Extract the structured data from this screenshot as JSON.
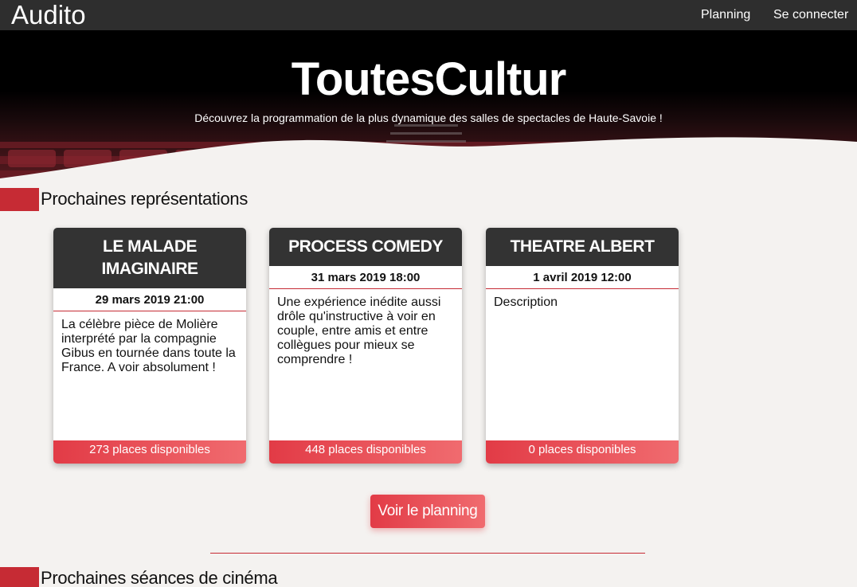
{
  "navbar": {
    "brand": "Audito",
    "links": [
      {
        "label": "Planning"
      },
      {
        "label": "Se connecter"
      }
    ]
  },
  "hero": {
    "title": "ToutesCultur",
    "subtitle": "Découvrez la programmation de la plus dynamique des salles de spectacles de Haute-Savoie !"
  },
  "sections": {
    "shows_title": "Prochaines représentations",
    "cinema_title": "Prochaines séances de cinéma"
  },
  "events": [
    {
      "title": "LE MALADE IMAGINAIRE",
      "date": "29 mars 2019 21:00",
      "description": "La célèbre pièce de Molière interprété par la compagnie Gibus en tournée dans toute la France. A voir absolument !",
      "seats": "273 places disponibles"
    },
    {
      "title": "PROCESS COMEDY",
      "date": "31 mars 2019 18:00",
      "description": "Une expérience inédite aussi drôle qu'instructive à voir en couple, entre amis et entre collègues pour mieux se comprendre !",
      "seats": "448 places disponibles"
    },
    {
      "title": "THEATRE ALBERT",
      "date": "1 avril 2019 12:00",
      "description": "Description",
      "seats": "0 places disponibles"
    }
  ],
  "actions": {
    "planning_button": "Voir le planning"
  },
  "colors": {
    "accent": "#c62b34",
    "button_start": "#e23b46",
    "button_end": "#f06b6f",
    "navbar": "#2e2e2e",
    "card_header": "#333333"
  }
}
